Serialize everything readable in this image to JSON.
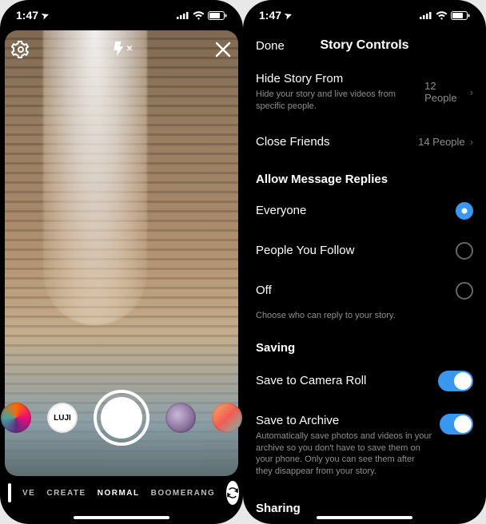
{
  "status": {
    "time": "1:47",
    "locationGlyph": "➤"
  },
  "camera": {
    "modes": {
      "live": "VE",
      "create": "CREATE",
      "normal": "NORMAL",
      "boomerang": "BOOMERANG"
    },
    "effects": {
      "lujiLabel": "LUJI"
    }
  },
  "settings": {
    "doneLabel": "Done",
    "title": "Story Controls",
    "hideStory": {
      "label": "Hide Story From",
      "value": "12 People",
      "sub": "Hide your story and live videos from specific people."
    },
    "closeFriends": {
      "label": "Close Friends",
      "value": "14 People"
    },
    "repliesSection": "Allow Message Replies",
    "replies": {
      "everyone": "Everyone",
      "following": "People You Follow",
      "off": "Off",
      "helper": "Choose who can reply to your story."
    },
    "savingSection": "Saving",
    "saveCameraRoll": {
      "label": "Save to Camera Roll"
    },
    "saveArchive": {
      "label": "Save to Archive",
      "sub": "Automatically save photos and videos in your archive so you don't have to save them on your phone. Only you can see them after they disappear from your story."
    },
    "sharingSection": "Sharing"
  }
}
